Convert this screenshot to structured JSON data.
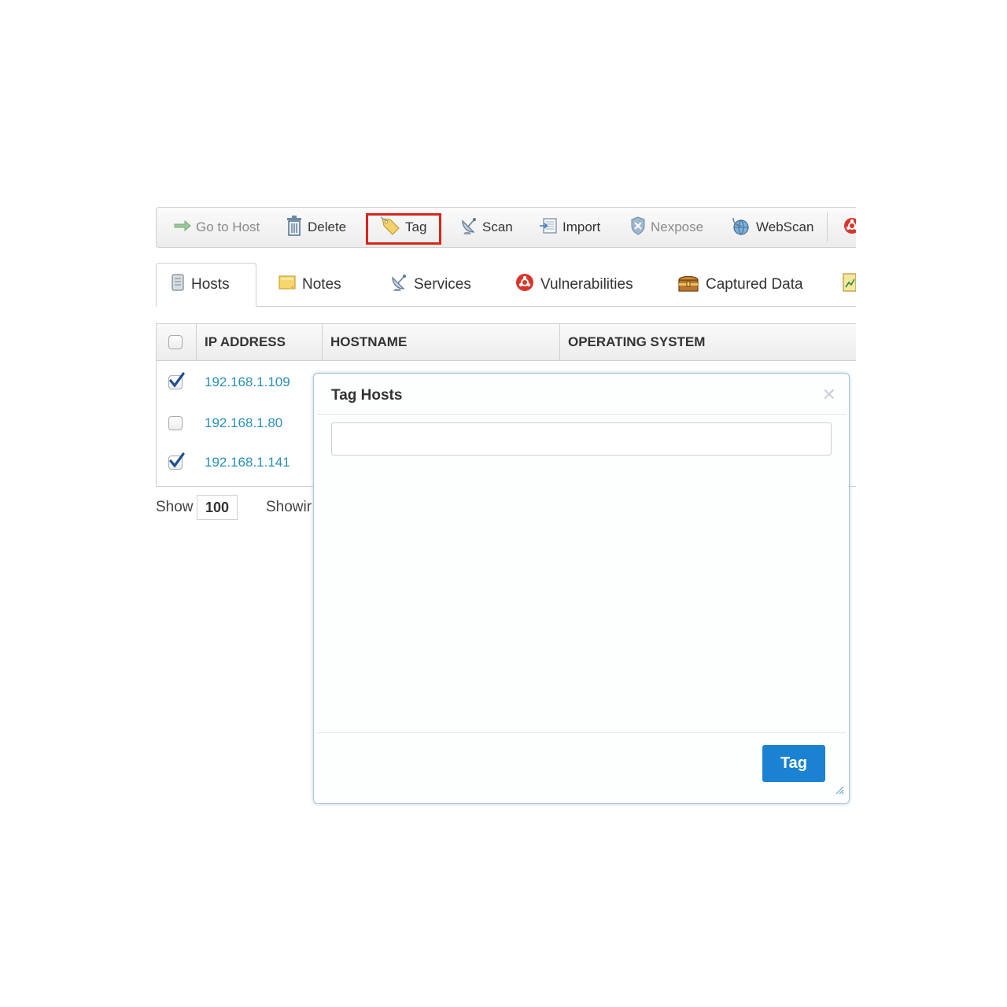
{
  "toolbar": {
    "go_to_host": "Go to Host",
    "delete": "Delete",
    "tag": "Tag",
    "scan": "Scan",
    "import": "Import",
    "nexpose": "Nexpose",
    "webscan": "WebScan"
  },
  "tabs": {
    "hosts": "Hosts",
    "notes": "Notes",
    "services": "Services",
    "vulnerabilities": "Vulnerabilities",
    "captured_data": "Captured Data"
  },
  "table": {
    "columns": [
      "IP ADDRESS",
      "HOSTNAME",
      "OPERATING SYSTEM"
    ],
    "rows": [
      {
        "ip": "192.168.1.109",
        "checked": true
      },
      {
        "ip": "192.168.1.80",
        "checked": false
      },
      {
        "ip": "192.168.1.141",
        "checked": true
      }
    ]
  },
  "footer": {
    "show_label": "Show",
    "page_size": "100",
    "showing_label": "Showir"
  },
  "dialog": {
    "title": "Tag Hosts",
    "input_value": "",
    "submit_label": "Tag"
  },
  "colors": {
    "accent": "#1b82d1",
    "link": "#2a8fb8",
    "highlight": "#d9261c"
  }
}
